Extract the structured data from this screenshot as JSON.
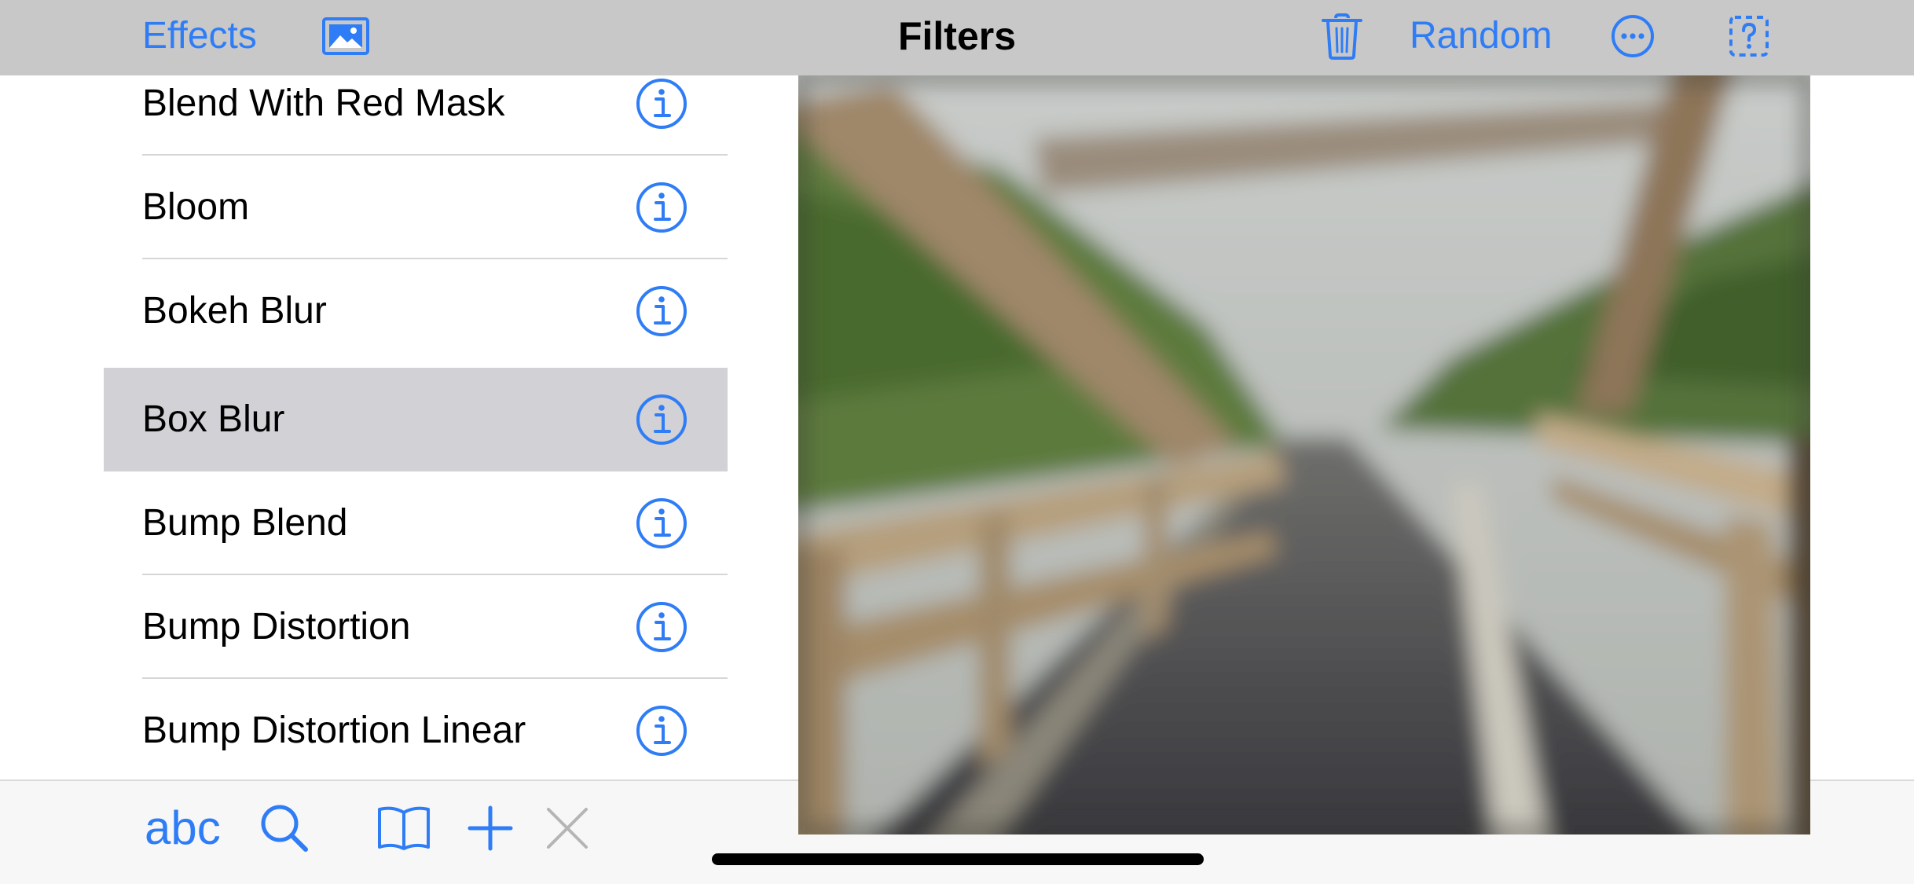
{
  "navbar": {
    "effects_label": "Effects",
    "title": "Filters",
    "random_label": "Random",
    "icons": {
      "photo": "photo-icon",
      "trash": "trash-icon",
      "more": "ellipsis-circle-icon",
      "help": "dashed-square-question-icon"
    }
  },
  "filters": {
    "items": [
      {
        "label": "Blend With Red Mask",
        "selected": false
      },
      {
        "label": "Bloom",
        "selected": false
      },
      {
        "label": "Bokeh Blur",
        "selected": false
      },
      {
        "label": "Box Blur",
        "selected": true
      },
      {
        "label": "Bump Blend",
        "selected": false
      },
      {
        "label": "Bump Distortion",
        "selected": false
      },
      {
        "label": "Bump Distortion Linear",
        "selected": false
      }
    ],
    "row_icon": "info-circle-icon"
  },
  "toolbar": {
    "abc_label": "abc",
    "icons": [
      "search-icon",
      "book-icon",
      "plus-icon",
      "close-icon"
    ]
  },
  "colors": {
    "accent": "#2f7df6",
    "navbar_bg": "#c8c8c8",
    "selected_row_bg": "#d1d1d6",
    "toolbar_bg": "#f7f7f7",
    "disabled": "#b5b5b5"
  }
}
